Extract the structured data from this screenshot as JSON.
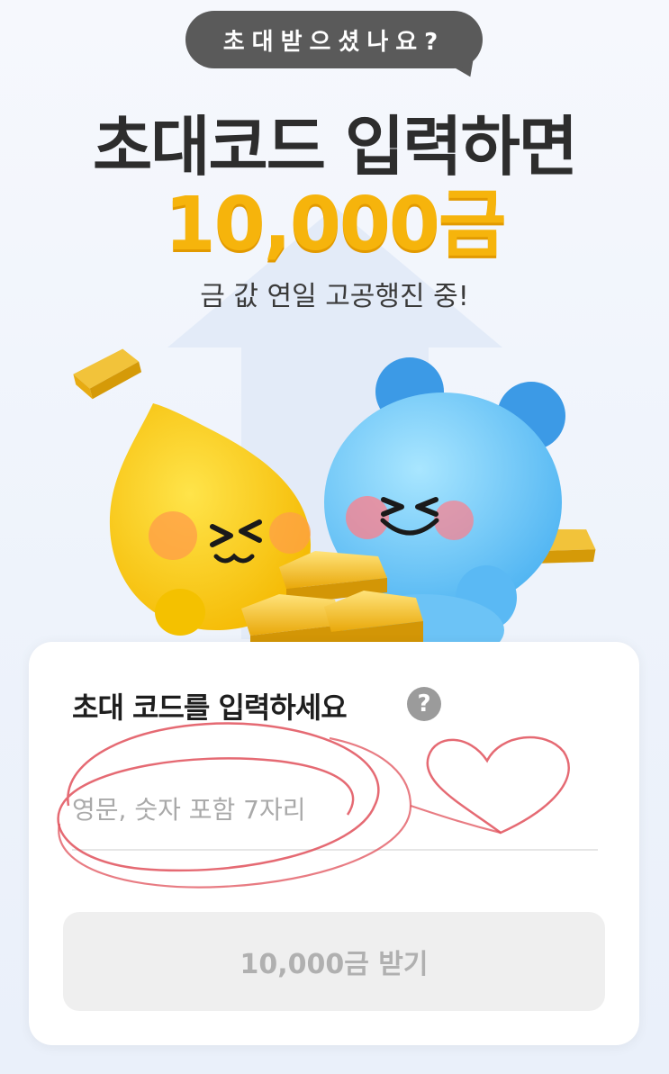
{
  "header": {
    "bubble_text": "초대받으셨나요?",
    "title": "초대코드 입력하면",
    "amount": "10,000금",
    "subtitle": "금 값 연일 고공행진 중!"
  },
  "form": {
    "heading": "초대 코드를 입력하세요",
    "help_symbol": "?",
    "input_placeholder": "영문, 숫자 포함 7자리",
    "input_value": "",
    "submit_label": "10,000금 받기"
  },
  "colors": {
    "gold": "#f6b40c",
    "bubble": "#5a5a5a",
    "disabled_button": "#efefef",
    "scribble": "#e0505a"
  },
  "icons": [
    "help-icon",
    "gold-bar-icon"
  ]
}
